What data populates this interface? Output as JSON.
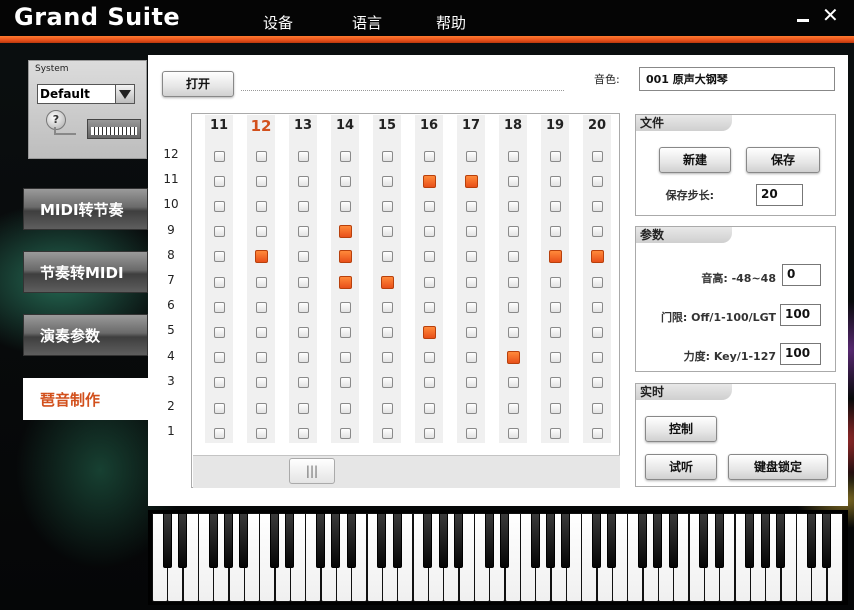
{
  "window": {
    "title": "Grand Suite",
    "menu": [
      "设备",
      "语言",
      "帮助"
    ],
    "minimize_icon": "minimize-icon",
    "close_icon": "close-icon",
    "close_glyph": "✕",
    "accent_color": "#e8501a"
  },
  "system": {
    "label": "System",
    "preset": "Default",
    "help_glyph": "?"
  },
  "nav": {
    "items": [
      "MIDI转节奏",
      "节奏转MIDI",
      "演奏参数",
      "琶音制作"
    ],
    "active_index": 3
  },
  "toolbar": {
    "open_label": "打开",
    "tone_label": "音色:",
    "tone_value": "001 原声大钢琴"
  },
  "grid": {
    "columns": [
      "11",
      "12",
      "13",
      "14",
      "15",
      "16",
      "17",
      "18",
      "19",
      "20"
    ],
    "highlight_column": "12",
    "rows": [
      "12",
      "11",
      "10",
      "9",
      "8",
      "7",
      "6",
      "5",
      "4",
      "3",
      "2",
      "1"
    ],
    "on_cells": [
      {
        "col": "16",
        "row": "11"
      },
      {
        "col": "17",
        "row": "11"
      },
      {
        "col": "14",
        "row": "9"
      },
      {
        "col": "12",
        "row": "8"
      },
      {
        "col": "14",
        "row": "8"
      },
      {
        "col": "19",
        "row": "8"
      },
      {
        "col": "20",
        "row": "8"
      },
      {
        "col": "14",
        "row": "7"
      },
      {
        "col": "15",
        "row": "7"
      },
      {
        "col": "16",
        "row": "5"
      },
      {
        "col": "18",
        "row": "4"
      }
    ],
    "scroll_thumb_glyph": "|||"
  },
  "file_group": {
    "title": "文件",
    "new_label": "新建",
    "save_label": "保存",
    "step_label": "保存步长:",
    "step_value": "20"
  },
  "param_group": {
    "title": "参数",
    "pitch_label": "音高: -48~48",
    "pitch_value": "0",
    "gate_label": "门限: Off/1-100/LGT",
    "gate_value": "100",
    "velocity_label": "力度: Key/1-127",
    "velocity_value": "100"
  },
  "realtime_group": {
    "title": "实时",
    "control_label": "控制",
    "listen_label": "试听",
    "lock_label": "键盘锁定"
  }
}
